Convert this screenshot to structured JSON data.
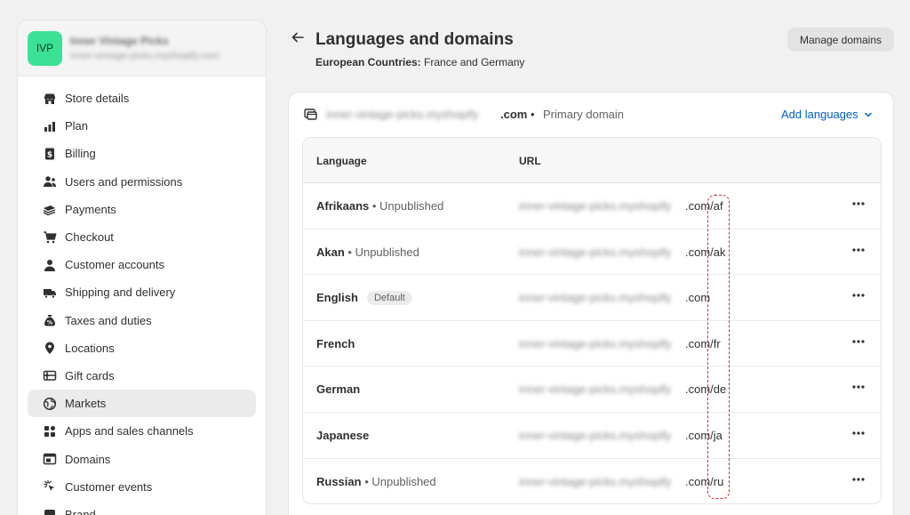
{
  "sidebar": {
    "avatar_initials": "IVP",
    "store_name": "Inner Vintage Picks",
    "store_url": "inner-vintage-picks.myshopify.com",
    "items": [
      {
        "label": "Store details",
        "icon": "store-icon"
      },
      {
        "label": "Plan",
        "icon": "plan-icon"
      },
      {
        "label": "Billing",
        "icon": "billing-icon"
      },
      {
        "label": "Users and permissions",
        "icon": "users-icon"
      },
      {
        "label": "Payments",
        "icon": "payments-icon"
      },
      {
        "label": "Checkout",
        "icon": "cart-icon"
      },
      {
        "label": "Customer accounts",
        "icon": "person-icon"
      },
      {
        "label": "Shipping and delivery",
        "icon": "truck-icon"
      },
      {
        "label": "Taxes and duties",
        "icon": "tax-bag-icon"
      },
      {
        "label": "Locations",
        "icon": "location-pin-icon"
      },
      {
        "label": "Gift cards",
        "icon": "gift-card-icon"
      },
      {
        "label": "Markets",
        "icon": "globe-icon",
        "active": true
      },
      {
        "label": "Apps and sales channels",
        "icon": "apps-icon"
      },
      {
        "label": "Domains",
        "icon": "domain-icon"
      },
      {
        "label": "Customer events",
        "icon": "cursor-click-icon"
      },
      {
        "label": "Brand",
        "icon": "brand-icon"
      }
    ]
  },
  "header": {
    "title": "Languages and domains",
    "subtitle_label": "European Countries:",
    "subtitle_value": "France and Germany",
    "manage_button": "Manage domains"
  },
  "card": {
    "domain_blurred": "inner-vintage-picks.myshopify",
    "domain_tld": ".com",
    "separator": "•",
    "primary_label": "Primary domain",
    "add_languages": "Add languages"
  },
  "table": {
    "headers": {
      "language": "Language",
      "url": "URL"
    },
    "rows": [
      {
        "language": "Afrikaans",
        "status": " • Unpublished",
        "badge": "",
        "url_base": "inner-vintage-picks.myshopify",
        "url_suffix": ".com/af"
      },
      {
        "language": "Akan",
        "status": " • Unpublished",
        "badge": "",
        "url_base": "inner-vintage-picks.myshopify",
        "url_suffix": ".com/ak"
      },
      {
        "language": "English",
        "status": "",
        "badge": "Default",
        "url_base": "inner-vintage-picks.myshopify",
        "url_suffix": ".com"
      },
      {
        "language": "French",
        "status": "",
        "badge": "",
        "url_base": "inner-vintage-picks.myshopify",
        "url_suffix": ".com/fr"
      },
      {
        "language": "German",
        "status": "",
        "badge": "",
        "url_base": "inner-vintage-picks.myshopify",
        "url_suffix": ".com/de"
      },
      {
        "language": "Japanese",
        "status": "",
        "badge": "",
        "url_base": "inner-vintage-picks.myshopify",
        "url_suffix": ".com/ja"
      },
      {
        "language": "Russian",
        "status": " • Unpublished",
        "badge": "",
        "url_base": "inner-vintage-picks.myshopify",
        "url_suffix": ".com/ru"
      }
    ]
  },
  "colors": {
    "accent_link": "#005bd3",
    "avatar_bg": "#3be195",
    "highlight": "#d9282f",
    "active_nav_bg": "#ebebeb"
  }
}
